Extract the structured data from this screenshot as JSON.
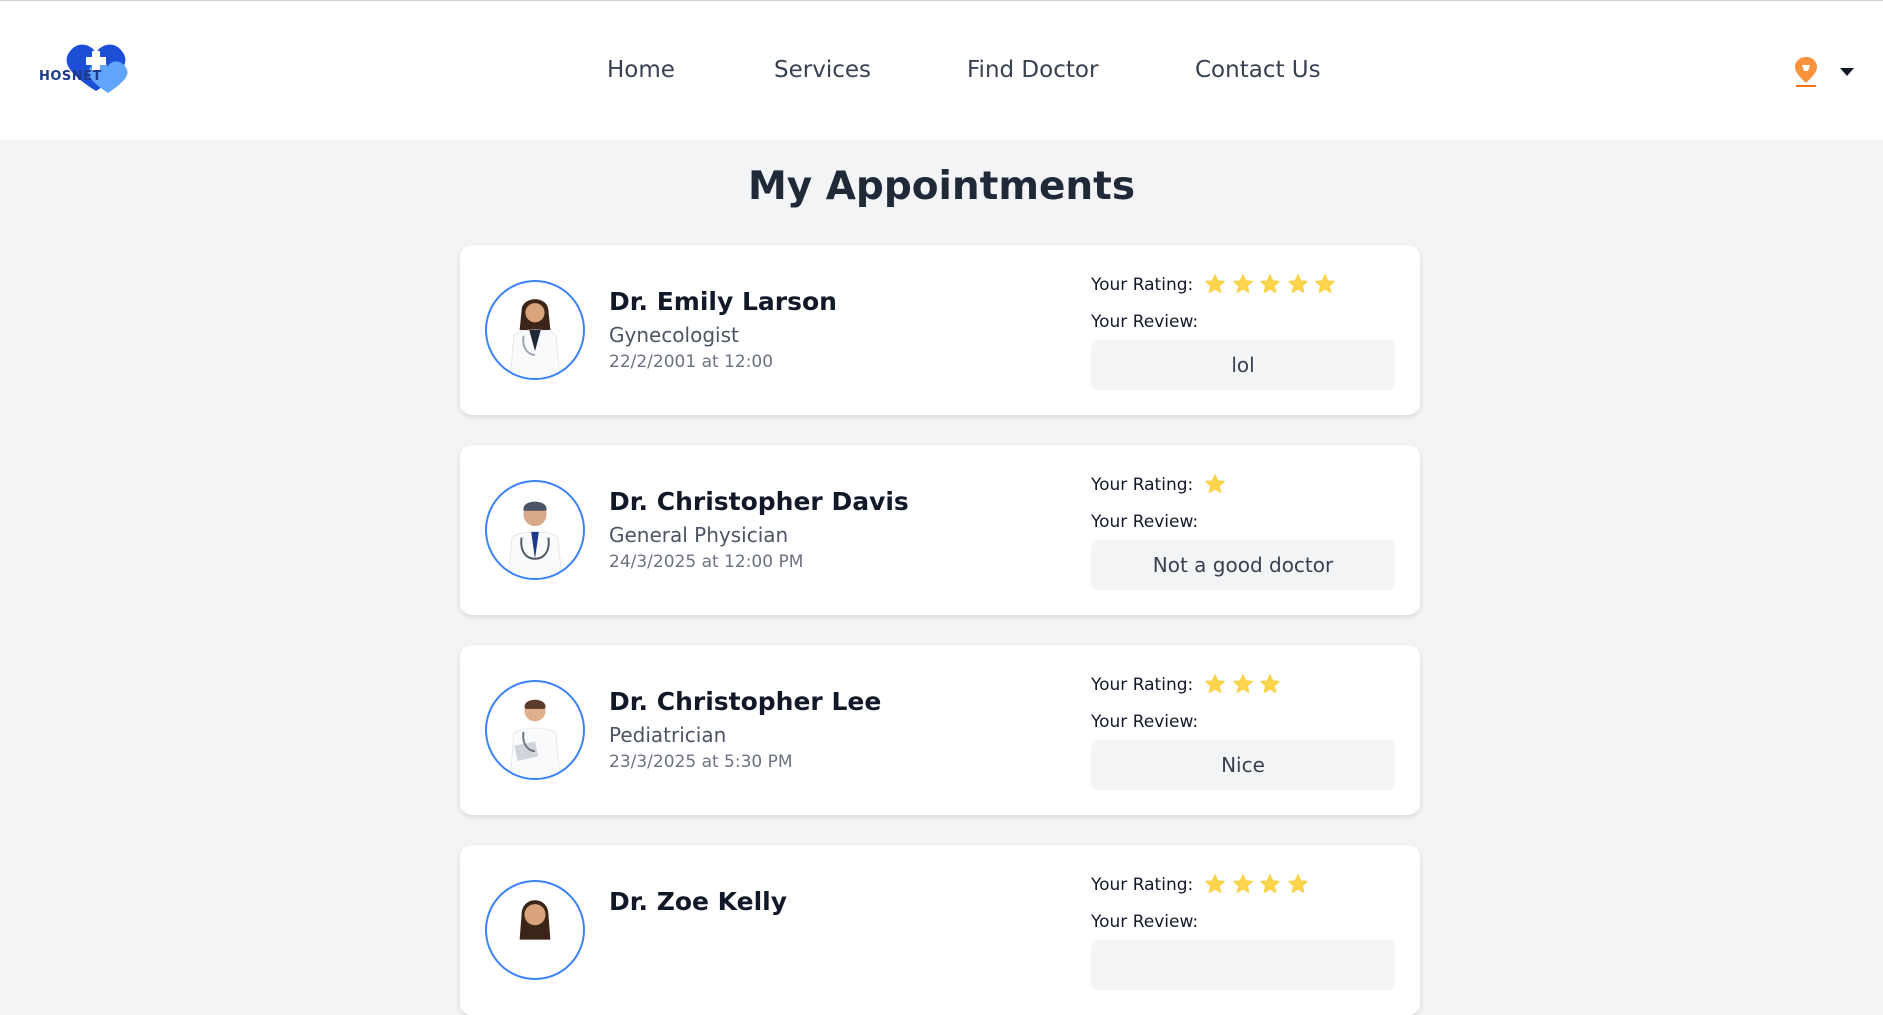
{
  "brand": {
    "logo_text": "HOSNET",
    "accent": "#1e3a8a",
    "heart_color": "#1d4ed8"
  },
  "nav": {
    "items": [
      {
        "label": "Home"
      },
      {
        "label": "Services"
      },
      {
        "label": "Find Doctor"
      },
      {
        "label": "Contact Us"
      }
    ],
    "profile_icon": "swiggy-logo-icon",
    "menu_icon": "caret-down-icon"
  },
  "page": {
    "title": "My Appointments"
  },
  "labels": {
    "rating": "Your Rating:",
    "review": "Your Review:"
  },
  "star_color": "#fcd34d",
  "appointments": [
    {
      "name": "Dr. Emily Larson",
      "specialty": "Gynecologist",
      "datetime": "22/2/2001 at 12:00",
      "rating": 5,
      "review": "lol"
    },
    {
      "name": "Dr. Christopher Davis",
      "specialty": "General Physician",
      "datetime": "24/3/2025 at 12:00 PM",
      "rating": 1,
      "review": "Not a good doctor"
    },
    {
      "name": "Dr. Christopher Lee",
      "specialty": "Pediatrician",
      "datetime": "23/3/2025 at 5:30 PM",
      "rating": 3,
      "review": "Nice"
    },
    {
      "name": "Dr. Zoe Kelly",
      "specialty": "",
      "datetime": "",
      "rating": 4,
      "review": ""
    }
  ]
}
